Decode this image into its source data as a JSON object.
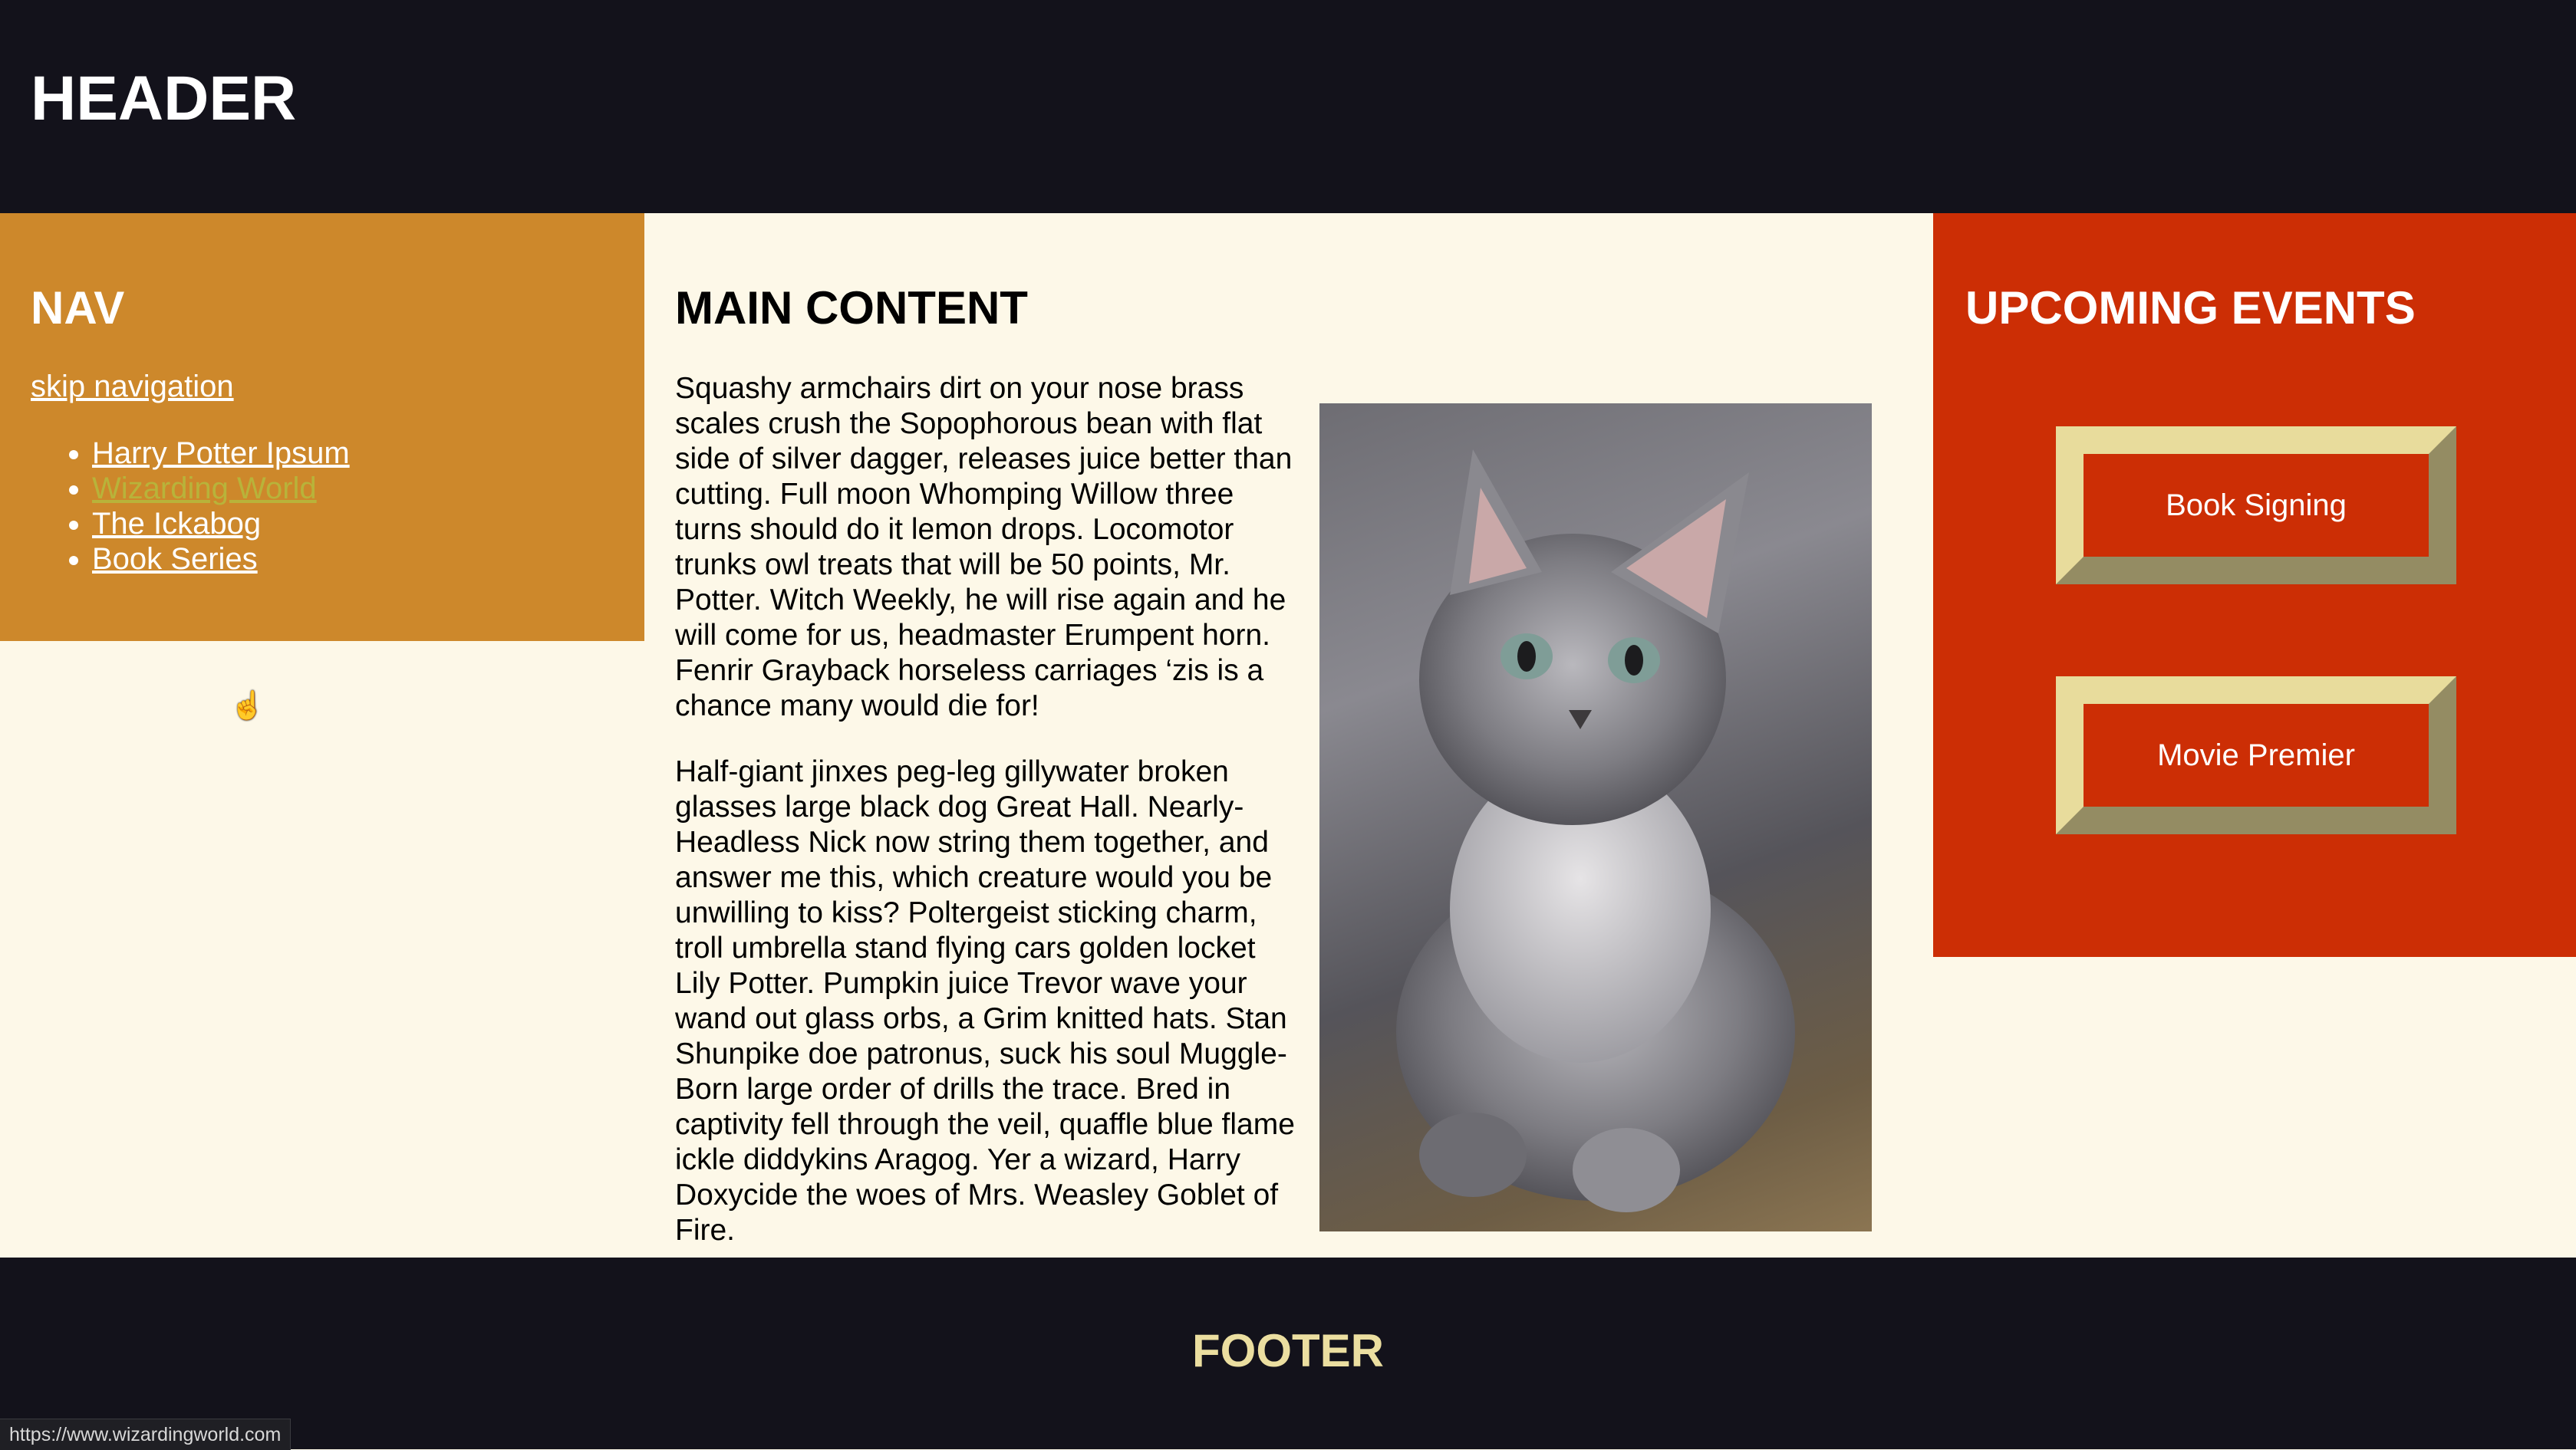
{
  "header": {
    "title": "HEADER"
  },
  "nav": {
    "heading": "NAV",
    "skip_link": "skip navigation",
    "items": [
      {
        "label": "Harry Potter Ipsum"
      },
      {
        "label": "Wizarding World"
      },
      {
        "label": "The Ickabog"
      },
      {
        "label": "Book Series"
      }
    ]
  },
  "main": {
    "heading": "MAIN CONTENT",
    "paragraphs": [
      "Squashy armchairs dirt on your nose brass scales crush the Sopophorous bean with flat side of silver dagger, releases juice better than cutting. Full moon Whomping Willow three turns should do it lemon drops. Locomotor trunks owl treats that will be 50 points, Mr. Potter. Witch Weekly, he will rise again and he will come for us, headmaster Erumpent horn. Fenrir Grayback horseless carriages ‘zis is a chance many would die for!",
      "Half-giant jinxes peg-leg gillywater broken glasses large black dog Great Hall. Nearly-Headless Nick now string them together, and answer me this, which creature would you be unwilling to kiss? Poltergeist sticking charm, troll umbrella stand flying cars golden locket Lily Potter. Pumpkin juice Trevor wave your wand out glass orbs, a Grim knitted hats. Stan Shunpike doe patronus, suck his soul Muggle-Born large order of drills the trace. Bred in captivity fell through the veil, quaffle blue flame ickle diddykins Aragog. Yer a wizard, Harry Doxycide the woes of Mrs. Weasley Goblet of Fire."
    ]
  },
  "events": {
    "heading": "UPCOMING EVENTS",
    "items": [
      {
        "label": "Book Signing"
      },
      {
        "label": "Movie Premier"
      }
    ]
  },
  "footer": {
    "title": "FOOTER"
  },
  "statusbar": {
    "url": "https://www.wizardingworld.com"
  },
  "colors": {
    "header_bg": "#13121b",
    "nav_bg": "#cd882b",
    "main_bg": "#fdf8e8",
    "events_bg": "#cc2e05",
    "button_border": "#e8dc9c",
    "footer_text": "#ebdea0",
    "link_hover": "#b8b33a"
  }
}
